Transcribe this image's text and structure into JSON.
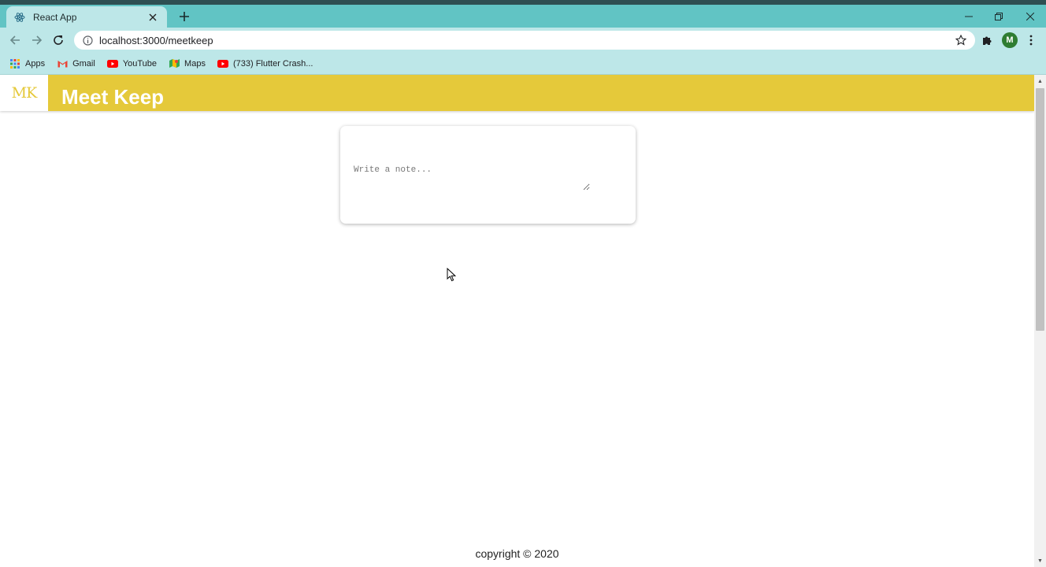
{
  "browser": {
    "tab": {
      "title": "React App",
      "favicon": "react-icon",
      "close_icon": "close-icon"
    },
    "new_tab_icon": "plus-icon",
    "window_controls": [
      "minimize-icon",
      "restore-icon",
      "close-icon"
    ],
    "toolbar": {
      "back_icon": "back-arrow-icon",
      "forward_icon": "forward-arrow-icon",
      "reload_icon": "reload-icon",
      "url": "localhost:3000/meetkeep",
      "profile_initial": "M"
    },
    "bookmarks": [
      {
        "label": "Apps",
        "icon": "apps-grid-icon"
      },
      {
        "label": "Gmail",
        "icon": "gmail-icon"
      },
      {
        "label": "YouTube",
        "icon": "youtube-icon"
      },
      {
        "label": "Maps",
        "icon": "maps-icon"
      },
      {
        "label": "(733) Flutter Crash...",
        "icon": "youtube-icon"
      }
    ]
  },
  "app": {
    "logo": "MK",
    "title": "Meet Keep",
    "note": {
      "placeholder": "Write a note...",
      "value": ""
    },
    "footer": "copyright © 2020"
  },
  "colors": {
    "header": "#e5c93a",
    "tab_bar": "#61c4c4",
    "toolbar": "#bde7e8",
    "profile": "#2e7d32"
  }
}
